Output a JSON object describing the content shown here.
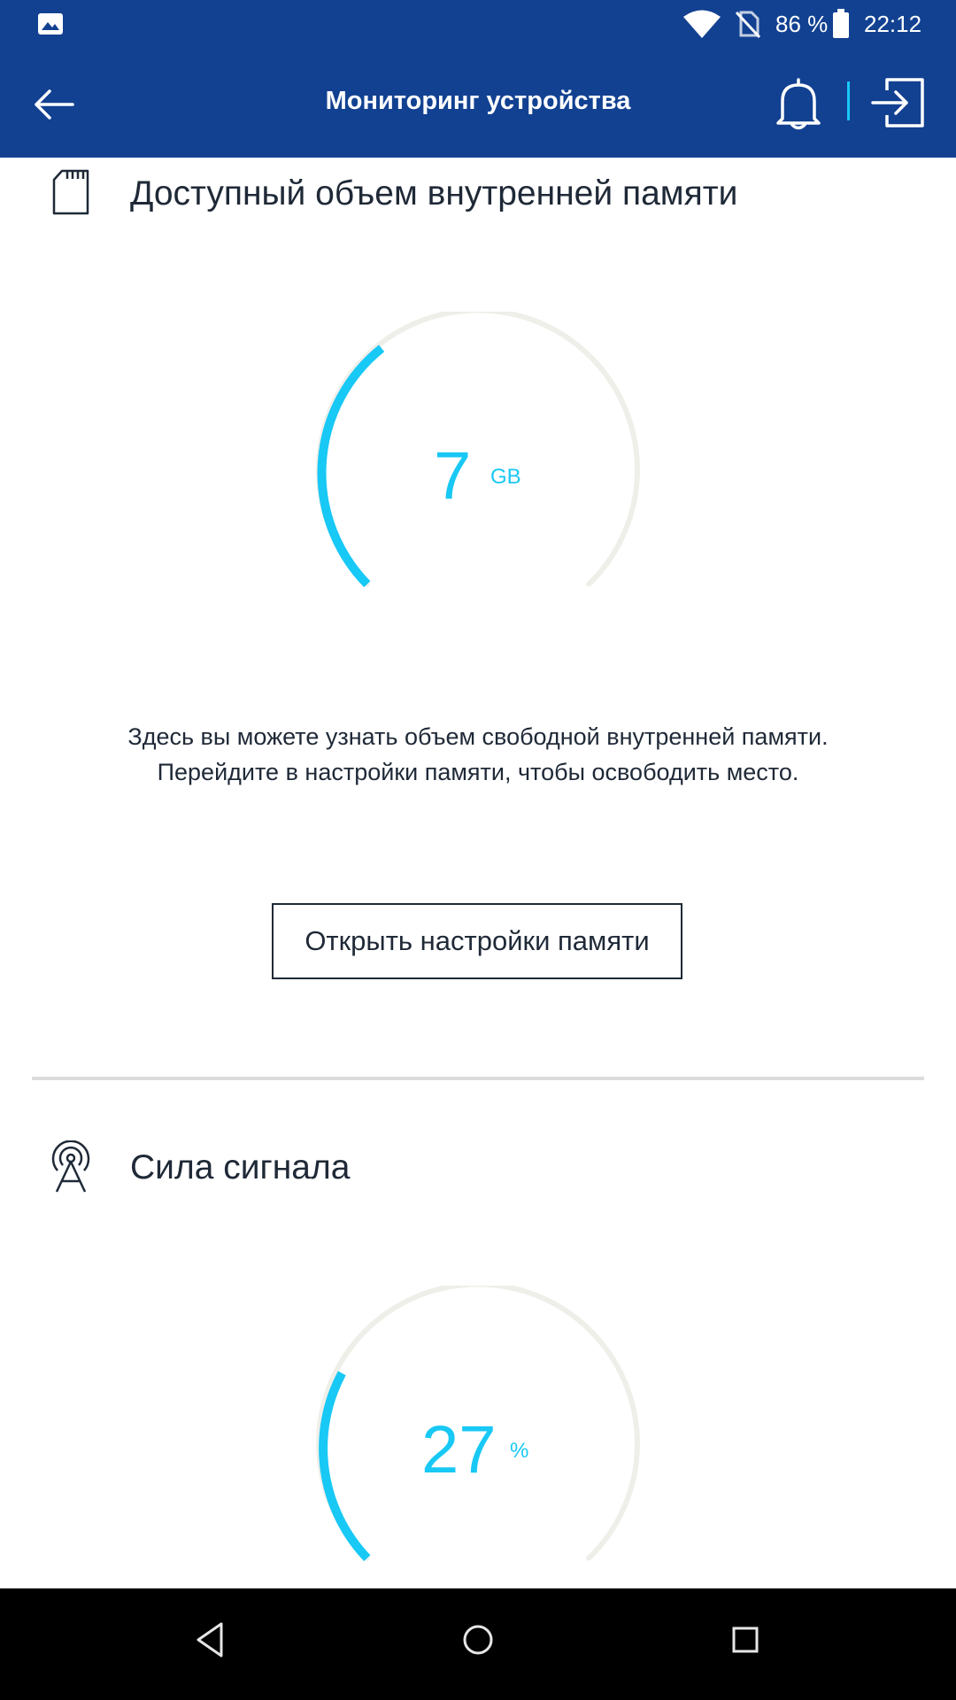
{
  "status_bar": {
    "battery_percent": "86 %",
    "time": "22:12",
    "icons": [
      "image-icon",
      "wifi-icon",
      "no-sim-icon",
      "battery-icon"
    ]
  },
  "app_bar": {
    "title": "Мониторинг устройства",
    "icons": [
      "back-arrow-icon",
      "bell-icon",
      "logout-icon"
    ]
  },
  "memory_section": {
    "title": "Доступный объем внутренней памяти",
    "icon": "sd-card-icon",
    "gauge": {
      "value": "7",
      "unit": "GB"
    },
    "description_line1": "Здесь вы можете узнать объем свободной внутренней памяти.",
    "description_line2": "Перейдите в настройки памяти, чтобы освободить место.",
    "button_label": "Открыть настройки памяти"
  },
  "signal_section": {
    "title": "Сила сигнала",
    "icon": "antenna-tower-icon",
    "gauge": {
      "value": "27",
      "unit": "%"
    }
  },
  "colors": {
    "brand_blue": "#124191",
    "accent_cyan": "#18c8f5",
    "gauge_track": "#efefea"
  }
}
